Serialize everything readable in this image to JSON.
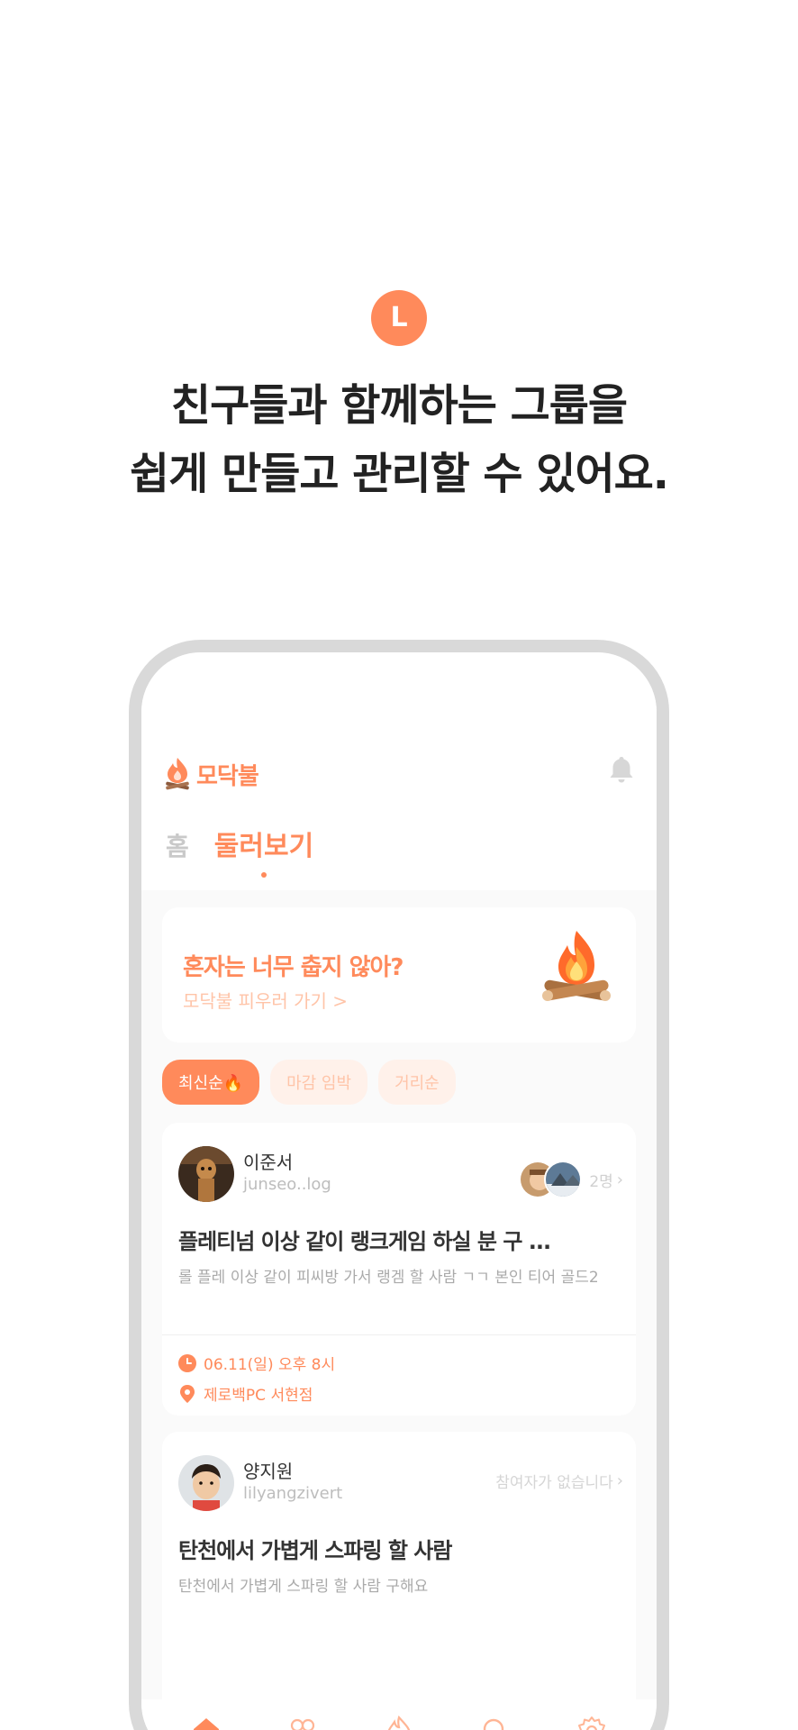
{
  "hero": {
    "badge_letter": "L",
    "title_line1": "친구들과 함께하는 그룹을",
    "title_line2": "쉽게 만들고 관리할 수 있어요."
  },
  "app": {
    "logo_text": "모닥불",
    "accent_color": "#FF8A5B",
    "tabs": [
      {
        "label": "홈",
        "active": false
      },
      {
        "label": "둘러보기",
        "active": true
      }
    ]
  },
  "banner": {
    "title": "혼자는 너무 춥지 않아?",
    "link": "모닥불 피우러 가기 >",
    "icon": "campfire-icon"
  },
  "filters": [
    {
      "label": "최신순🔥",
      "active": true
    },
    {
      "label": "마감 임박",
      "active": false
    },
    {
      "label": "거리순",
      "active": false
    }
  ],
  "posts": [
    {
      "author": "이준서",
      "handle": "junseo..log",
      "participants_label": "2명",
      "title": "플레티넘 이상 같이 랭크게임 하실 분 구 ...",
      "body": "롤 플레 이상 같이 피씨방 가서 랭겜 할 사람 ㄱㄱ 본인 티어 골드2",
      "datetime": "06.11(일) 오후 8시",
      "location": "제로백PC 서현점"
    },
    {
      "author": "양지원",
      "handle": "lilyangzivert",
      "participants_label": "참여자가 없습니다",
      "title": "탄천에서 가볍게 스파링 할 사람",
      "body": "탄천에서 가볍게 스파링 할 사람 구해요 "
    }
  ],
  "tabbar": [
    {
      "icon": "home-icon",
      "active": true
    },
    {
      "icon": "people-icon",
      "active": false
    },
    {
      "icon": "fire-icon",
      "active": false
    },
    {
      "icon": "search-icon",
      "active": false
    },
    {
      "icon": "gear-icon",
      "active": false
    }
  ]
}
